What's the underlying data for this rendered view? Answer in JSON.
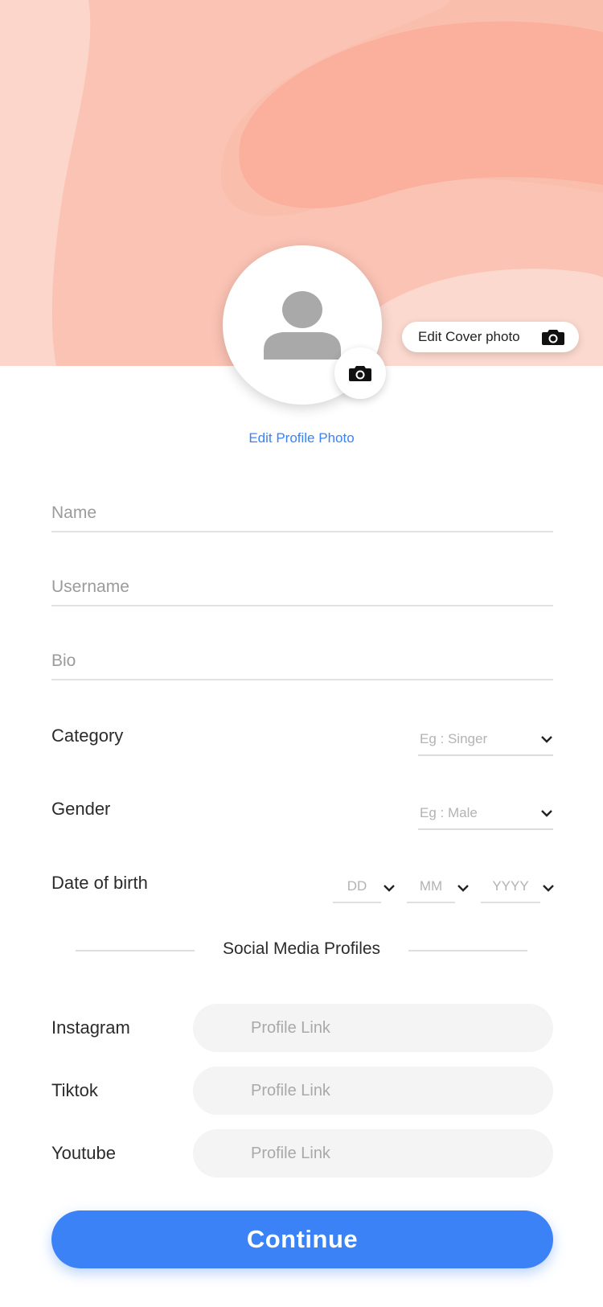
{
  "cover": {
    "colors": {
      "base": "#fbc8b9",
      "blob": "#f9ab97",
      "accent": "#fcd8ce"
    },
    "edit_cover_label": "Edit Cover photo",
    "edit_cover_icon": "camera-icon"
  },
  "profile": {
    "avatar_icon": "user-placeholder-icon",
    "camera_icon": "camera-icon",
    "edit_photo_label": "Edit Profile Photo"
  },
  "form": {
    "name": {
      "placeholder": "Name",
      "value": ""
    },
    "username": {
      "placeholder": "Username",
      "value": ""
    },
    "bio": {
      "placeholder": "Bio",
      "value": ""
    },
    "category": {
      "label": "Category",
      "placeholder": "Eg : Singer"
    },
    "gender": {
      "label": "Gender",
      "placeholder": "Eg : Male"
    },
    "dob": {
      "label": "Date of birth",
      "day": "DD",
      "month": "MM",
      "year": "YYYY"
    }
  },
  "social": {
    "heading": "Social Media Profiles",
    "instagram": {
      "label": "Instagram",
      "placeholder": "Profile Link"
    },
    "tiktok": {
      "label": "Tiktok",
      "placeholder": "Profile Link"
    },
    "youtube": {
      "label": "Youtube",
      "placeholder": "Profile Link"
    }
  },
  "continue_label": "Continue",
  "accent_color": "#3b82f6"
}
